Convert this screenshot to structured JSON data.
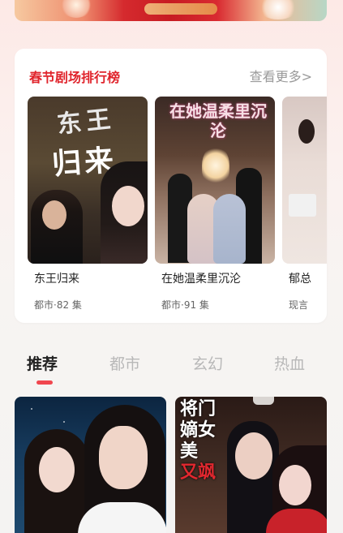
{
  "ranking": {
    "title": "春节剧场排行榜",
    "more_label": "查看更多>",
    "shows": [
      {
        "poster_text_1": "东王",
        "poster_text_2": "归来",
        "name": "东王归来",
        "meta": "都市·82 集"
      },
      {
        "poster_text": "在她温柔里沉沦",
        "name": "在她温柔里沉沦",
        "meta": "都市·91 集"
      },
      {
        "name": "郁总",
        "meta": "现言"
      }
    ]
  },
  "tabs": {
    "items": [
      "推荐",
      "都市",
      "玄幻",
      "热血"
    ],
    "active_index": 0
  },
  "feed": {
    "items": [
      {
        "poster_text": ""
      },
      {
        "poster_text_a": "将门",
        "poster_text_b": "嫡女",
        "poster_text_c": "美",
        "poster_text_d": "又飒"
      }
    ]
  },
  "colors": {
    "accent": "#e0242c",
    "tab_indicator": "#f0464e",
    "muted_text": "#9a9a9a"
  }
}
